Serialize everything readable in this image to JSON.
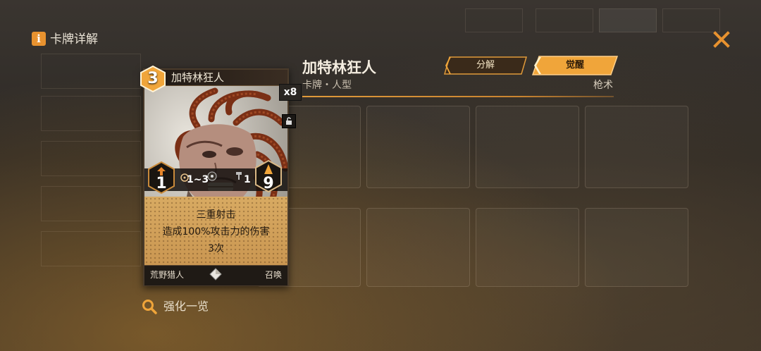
{
  "header": {
    "title": "卡牌详解",
    "info_icon": "info-icon",
    "close_icon": "close-x-icon"
  },
  "card": {
    "name": "加特林狂人",
    "cost": "3",
    "count": "x8",
    "lock_icon": "unlock-icon",
    "stats": {
      "left": "1",
      "range": "1~3",
      "small": "1",
      "right": "9"
    },
    "effect": {
      "line1": "三重射击",
      "line2": "造成100%攻击力的伤害",
      "line3": "3次"
    },
    "faction": "荒野猎人",
    "type": "召唤"
  },
  "info": {
    "title": "加特林狂人",
    "subtitle": "卡牌・人型",
    "tag": "枪术",
    "buttons": {
      "decompose": "分解",
      "awaken": "觉醒"
    }
  },
  "footer": {
    "enhance_label": "强化一览",
    "search_icon": "magnifier-icon"
  },
  "colors": {
    "accent": "#e8922f",
    "card_text_bg": "#d8aa62",
    "awaken_btn": "#f0a53a"
  }
}
